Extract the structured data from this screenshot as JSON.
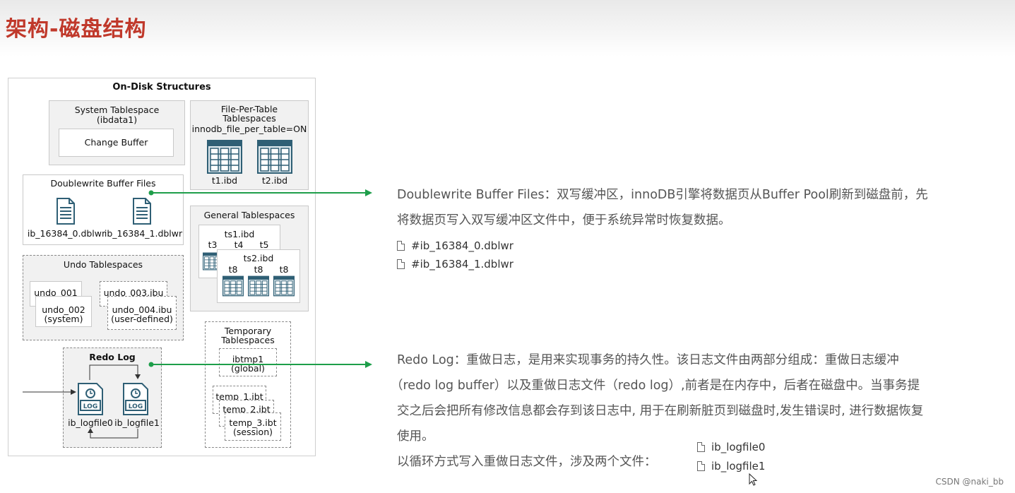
{
  "page_title": "架构-磁盘结构",
  "diagram": {
    "heading": "On-Disk Structures",
    "system_tablespace": {
      "title_line1": "System Tablespace",
      "title_line2": "(ibdata1)",
      "change_buffer": "Change Buffer"
    },
    "file_per_table": {
      "title_line1": "File-Per-Table",
      "title_line2": "Tablespaces",
      "setting": "innodb_file_per_table=ON",
      "files": [
        "t1.ibd",
        "t2.ibd"
      ]
    },
    "doublewrite": {
      "title": "Doublewrite Buffer Files",
      "files": [
        "ib_16384_0.dblwr",
        "ib_16384_1.dblwr"
      ]
    },
    "general": {
      "title": "General Tablespaces",
      "ts1": "ts1.ibd",
      "ts1_tables": [
        "t3",
        "t4",
        "t5"
      ],
      "ts2": "ts2.ibd",
      "ts2_tables": [
        "t8",
        "t8",
        "t8"
      ]
    },
    "undo": {
      "title": "Undo Tablespaces",
      "u1": "undo_001",
      "u2_line1": "undo_002",
      "u2_line2": "(system)",
      "u3": "undo_003.ibu",
      "u4_line1": "undo_004.ibu",
      "u4_line2": "(user-defined)"
    },
    "redo": {
      "title": "Redo Log",
      "icon_text": "LOG",
      "files": [
        "ib_logfile0",
        "ib_logfile1"
      ]
    },
    "temporary": {
      "title_line1": "Temporary",
      "title_line2": "Tablespaces",
      "ibtmp_line1": "ibtmp1",
      "ibtmp_line2": "(global)",
      "temp1": "temp_1.ibt",
      "temp2": "temp_2.ibt",
      "temp3_line1": "temp_3.ibt",
      "temp3_line2": "(session)"
    }
  },
  "doublewrite_desc": {
    "line1": "Doublewrite Buffer Files：双写缓冲区，innoDB引擎将数据页从Buffer Pool刷新到磁盘前，先",
    "line2": "将数据页写入双写缓冲区文件中，便于系统异常时恢复数据。",
    "files": [
      "#ib_16384_0.dblwr",
      "#ib_16384_1.dblwr"
    ]
  },
  "redo_desc": {
    "line1": "Redo Log：重做日志，是用来实现事务的持久性。该日志文件由两部分组成：重做日志缓冲",
    "line2": "（redo log buffer）以及重做日志文件（redo log）,前者是在内存中，后者在磁盘中。当事务提",
    "line3": "交之后会把所有修改信息都会存到该日志中, 用于在刷新脏页到磁盘时,发生错误时, 进行数据恢复",
    "line4": "使用。",
    "line5": "以循环方式写入重做日志文件，涉及两个文件：",
    "files": [
      "ib_logfile0",
      "ib_logfile1"
    ]
  },
  "watermark": "CSDN @naki_bb",
  "colors": {
    "title": "#c0392b",
    "arrow": "#1e9e4a",
    "db_icon": "#2f5f75"
  }
}
